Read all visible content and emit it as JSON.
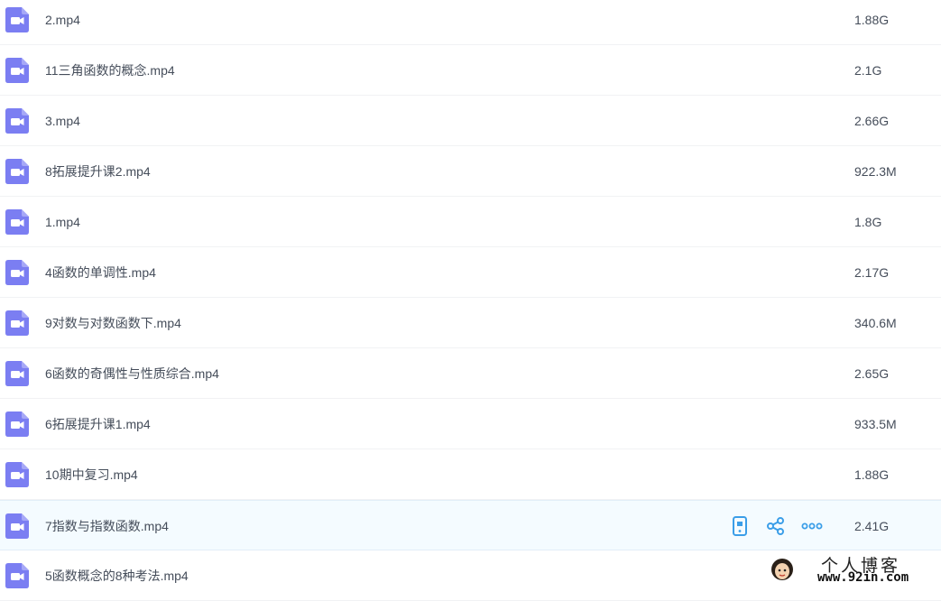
{
  "files": [
    {
      "name": "2.mp4",
      "size": "1.88G"
    },
    {
      "name": "11三角函数的概念.mp4",
      "size": "2.1G"
    },
    {
      "name": "3.mp4",
      "size": "2.66G"
    },
    {
      "name": "8拓展提升课2.mp4",
      "size": "922.3M"
    },
    {
      "name": "1.mp4",
      "size": "1.8G"
    },
    {
      "name": "4函数的单调性.mp4",
      "size": "2.17G"
    },
    {
      "name": "9对数与对数函数下.mp4",
      "size": "340.6M"
    },
    {
      "name": "6函数的奇偶性与性质综合.mp4",
      "size": "2.65G"
    },
    {
      "name": "6拓展提升课1.mp4",
      "size": "933.5M"
    },
    {
      "name": "10期中复习.mp4",
      "size": "1.88G"
    },
    {
      "name": "7指数与指数函数.mp4",
      "size": "2.41G"
    },
    {
      "name": "5函数概念的8种考法.mp4",
      "size": ""
    }
  ],
  "hovered_row_index": 10,
  "row_actions": [
    {
      "icon": "phone-icon"
    },
    {
      "icon": "share-icon"
    },
    {
      "icon": "more-icon"
    }
  ],
  "colors": {
    "file_icon": "#7b7ef2",
    "action_icon": "#3b9ee8",
    "hover_bg": "#f4fbff"
  },
  "watermark": {
    "title": "个人博客",
    "url": "www.92in.com"
  }
}
